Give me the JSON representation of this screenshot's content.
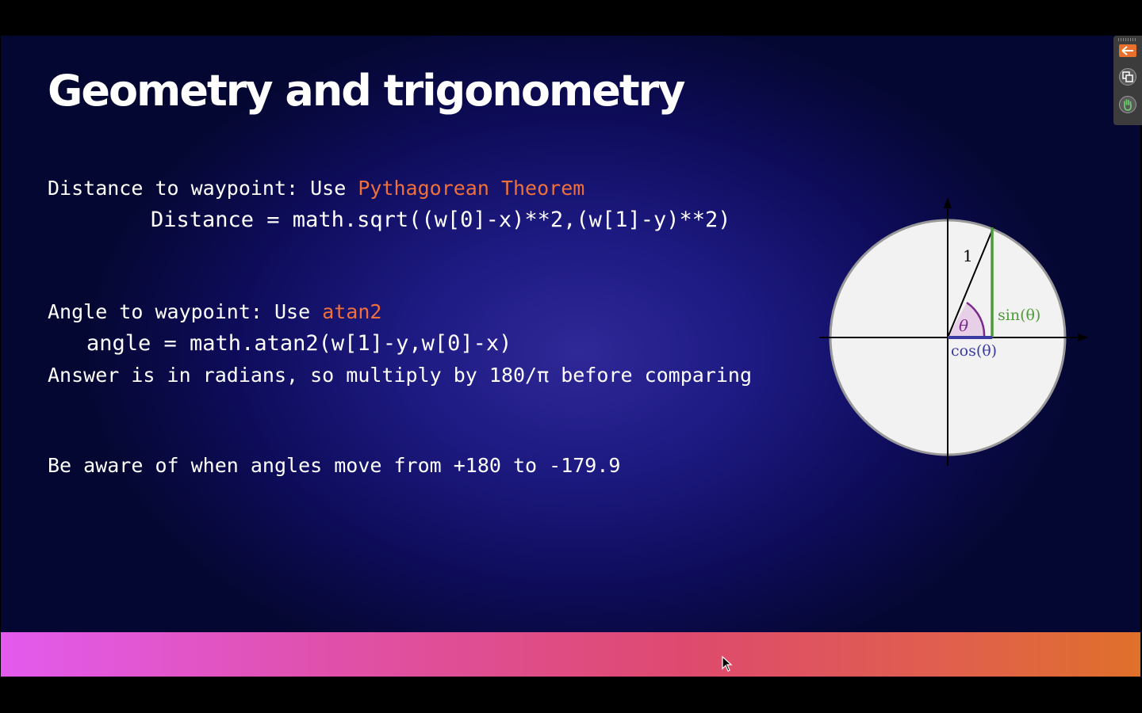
{
  "slide": {
    "title": "Geometry and trigonometry",
    "distance_prefix": "Distance to waypoint: Use ",
    "distance_highlight": "Pythagorean Theorem",
    "distance_formula": "Distance = math.sqrt((w[0]-x)**2,(w[1]-y)**2)",
    "angle_prefix": "Angle to waypoint: Use ",
    "angle_highlight": "atan2",
    "angle_formula": "angle = math.atan2(w[1]-y,w[0]-x)",
    "radians_note": "Answer is in radians, so multiply by 180/π before comparing",
    "wrap_note": "Be aware of when angles move from +180 to -179.9"
  },
  "unit_circle": {
    "radius_label": "1",
    "theta_label": "θ",
    "sin_label": "sin(θ)",
    "cos_label": "cos(θ)"
  },
  "toolbar": {
    "back_icon": "arrow-left-icon",
    "copy_icon": "copy-icon",
    "hand_icon": "hand-icon"
  },
  "colors": {
    "highlight": "#f0703a",
    "sin": "#4f9a3a",
    "cos": "#3a3aa0",
    "theta": "#7a2a8a"
  }
}
